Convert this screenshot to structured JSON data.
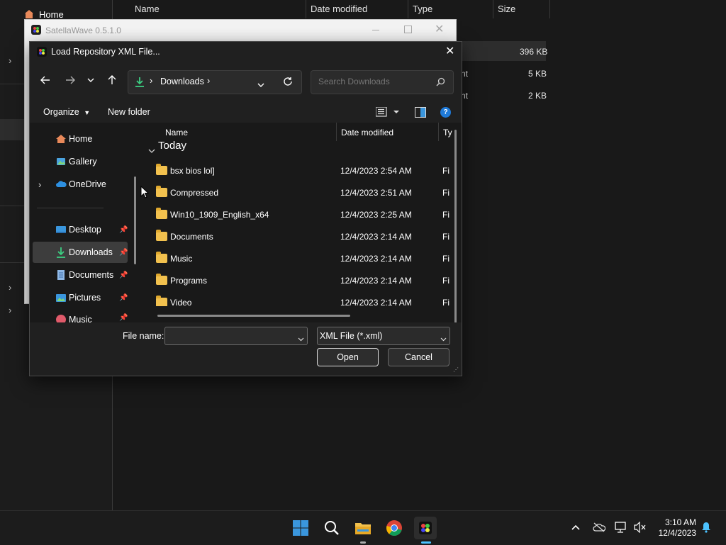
{
  "background_explorer": {
    "home_label": "Home",
    "columns": [
      "Name",
      "Date modified",
      "Type",
      "Size"
    ],
    "rows": [
      {
        "type_fragment": "",
        "size": "396 KB"
      },
      {
        "type_fragment": "nt",
        "size": "5 KB"
      },
      {
        "type_fragment": "nt",
        "size": "2 KB"
      }
    ]
  },
  "app_window": {
    "title": "SatellaWave 0.5.1.0"
  },
  "dialog": {
    "title": "Load Repository XML File...",
    "breadcrumb": {
      "location": "Downloads"
    },
    "search": {
      "placeholder": "Search Downloads"
    },
    "commands": {
      "organize": "Organize",
      "new_folder": "New folder"
    },
    "sidebar": [
      {
        "label": "Home",
        "icon": "home-icon",
        "pinned": false
      },
      {
        "label": "Gallery",
        "icon": "gallery-icon",
        "pinned": false
      },
      {
        "label": "OneDrive",
        "icon": "cloud-icon",
        "pinned": false
      },
      {
        "label": "Desktop",
        "icon": "desktop-icon",
        "pinned": true
      },
      {
        "label": "Downloads",
        "icon": "download-icon",
        "pinned": true,
        "selected": true
      },
      {
        "label": "Documents",
        "icon": "document-icon",
        "pinned": true
      },
      {
        "label": "Pictures",
        "icon": "pictures-icon",
        "pinned": true
      },
      {
        "label": "Music",
        "icon": "music-icon",
        "pinned": true
      }
    ],
    "columns": {
      "name": "Name",
      "date": "Date modified",
      "type": "Ty"
    },
    "group": "Today",
    "files": [
      {
        "name": "bsx bios lol]",
        "date": "12/4/2023 2:54 AM",
        "type": "Fi"
      },
      {
        "name": "Compressed",
        "date": "12/4/2023 2:51 AM",
        "type": "Fi"
      },
      {
        "name": "Win10_1909_English_x64",
        "date": "12/4/2023 2:25 AM",
        "type": "Fi"
      },
      {
        "name": "Documents",
        "date": "12/4/2023 2:14 AM",
        "type": "Fi"
      },
      {
        "name": "Music",
        "date": "12/4/2023 2:14 AM",
        "type": "Fi"
      },
      {
        "name": "Programs",
        "date": "12/4/2023 2:14 AM",
        "type": "Fi"
      },
      {
        "name": "Video",
        "date": "12/4/2023 2:14 AM",
        "type": "Fi"
      }
    ],
    "footer": {
      "file_name_label": "File name:",
      "file_name_value": "",
      "file_type": "XML File (*.xml)",
      "open": "Open",
      "cancel": "Cancel"
    }
  },
  "taskbar": {
    "time": "3:10 AM",
    "date": "12/4/2023"
  },
  "colors": {
    "accent": "#0078d4",
    "folder": "#f2c14e",
    "selected_bg": "#3d3d3d"
  }
}
